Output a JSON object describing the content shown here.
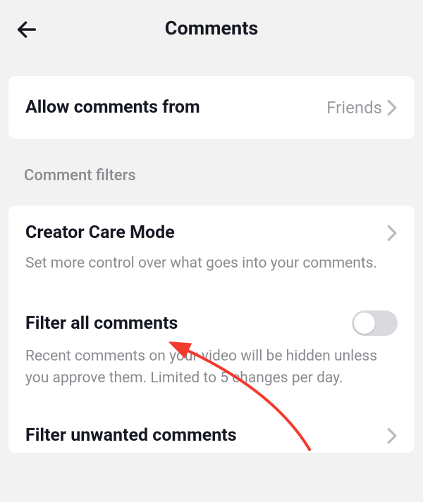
{
  "header": {
    "title": "Comments"
  },
  "allow": {
    "label": "Allow comments from",
    "value": "Friends"
  },
  "section": {
    "title": "Comment filters"
  },
  "settings": {
    "creator": {
      "title": "Creator Care Mode",
      "desc": "Set more control over what goes into your comments."
    },
    "filterAll": {
      "title": "Filter all comments",
      "desc": "Recent comments on your video will be hidden unless you approve them. Limited to 5 changes per day."
    },
    "unwanted": {
      "title": "Filter unwanted comments"
    }
  }
}
